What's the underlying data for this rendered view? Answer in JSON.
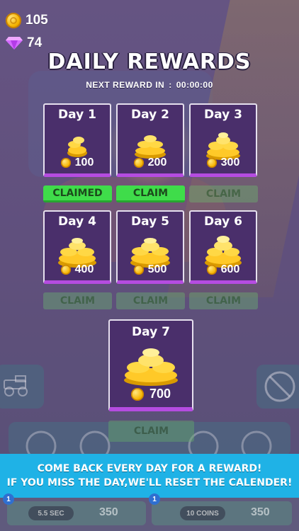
{
  "currency": {
    "coins": "105",
    "gems": "74"
  },
  "header": {
    "title": "DAILY REWARDS",
    "next_label": "NEXT REWARD IN",
    "next_sep": ":",
    "next_time": "00:00:00"
  },
  "days": [
    {
      "label": "Day 1",
      "amount": "100",
      "button": "CLAIMED",
      "state": "claimed"
    },
    {
      "label": "Day 2",
      "amount": "200",
      "button": "CLAIM",
      "state": "active"
    },
    {
      "label": "Day 3",
      "amount": "300",
      "button": "CLAIM",
      "state": "locked"
    },
    {
      "label": "Day 4",
      "amount": "400",
      "button": "CLAIM",
      "state": "locked"
    },
    {
      "label": "Day 5",
      "amount": "500",
      "button": "CLAIM",
      "state": "locked"
    },
    {
      "label": "Day 6",
      "amount": "600",
      "button": "CLAIM",
      "state": "locked"
    },
    {
      "label": "Day 7",
      "amount": "700",
      "button": "CLAIM",
      "state": "locked"
    }
  ],
  "banner": {
    "line1": "COME BACK EVERY DAY FOR A REWARD!",
    "line2": "IF YOU MISS THE DAY,WE'LL RESET THE CALENDER!"
  },
  "background": {
    "badge_left": "1",
    "badge_right": "1",
    "timer": "5.5 SEC",
    "coins_pill": "10 COINS",
    "price_left": "350",
    "price_right": "350",
    "no_ads": "NO ADS"
  },
  "colors": {
    "card_bg": "#4a2f6b",
    "claim_green": "#3fdc4a",
    "banner_blue": "#1fb2e6",
    "card_accent": "#b54ce0"
  },
  "icons": [
    "coin-icon",
    "gem-icon",
    "coin-pile",
    "truck-icon",
    "no-ads-icon",
    "leaderboard-icon",
    "star-icon",
    "gift-icon",
    "cart-icon",
    "gear-icon"
  ]
}
